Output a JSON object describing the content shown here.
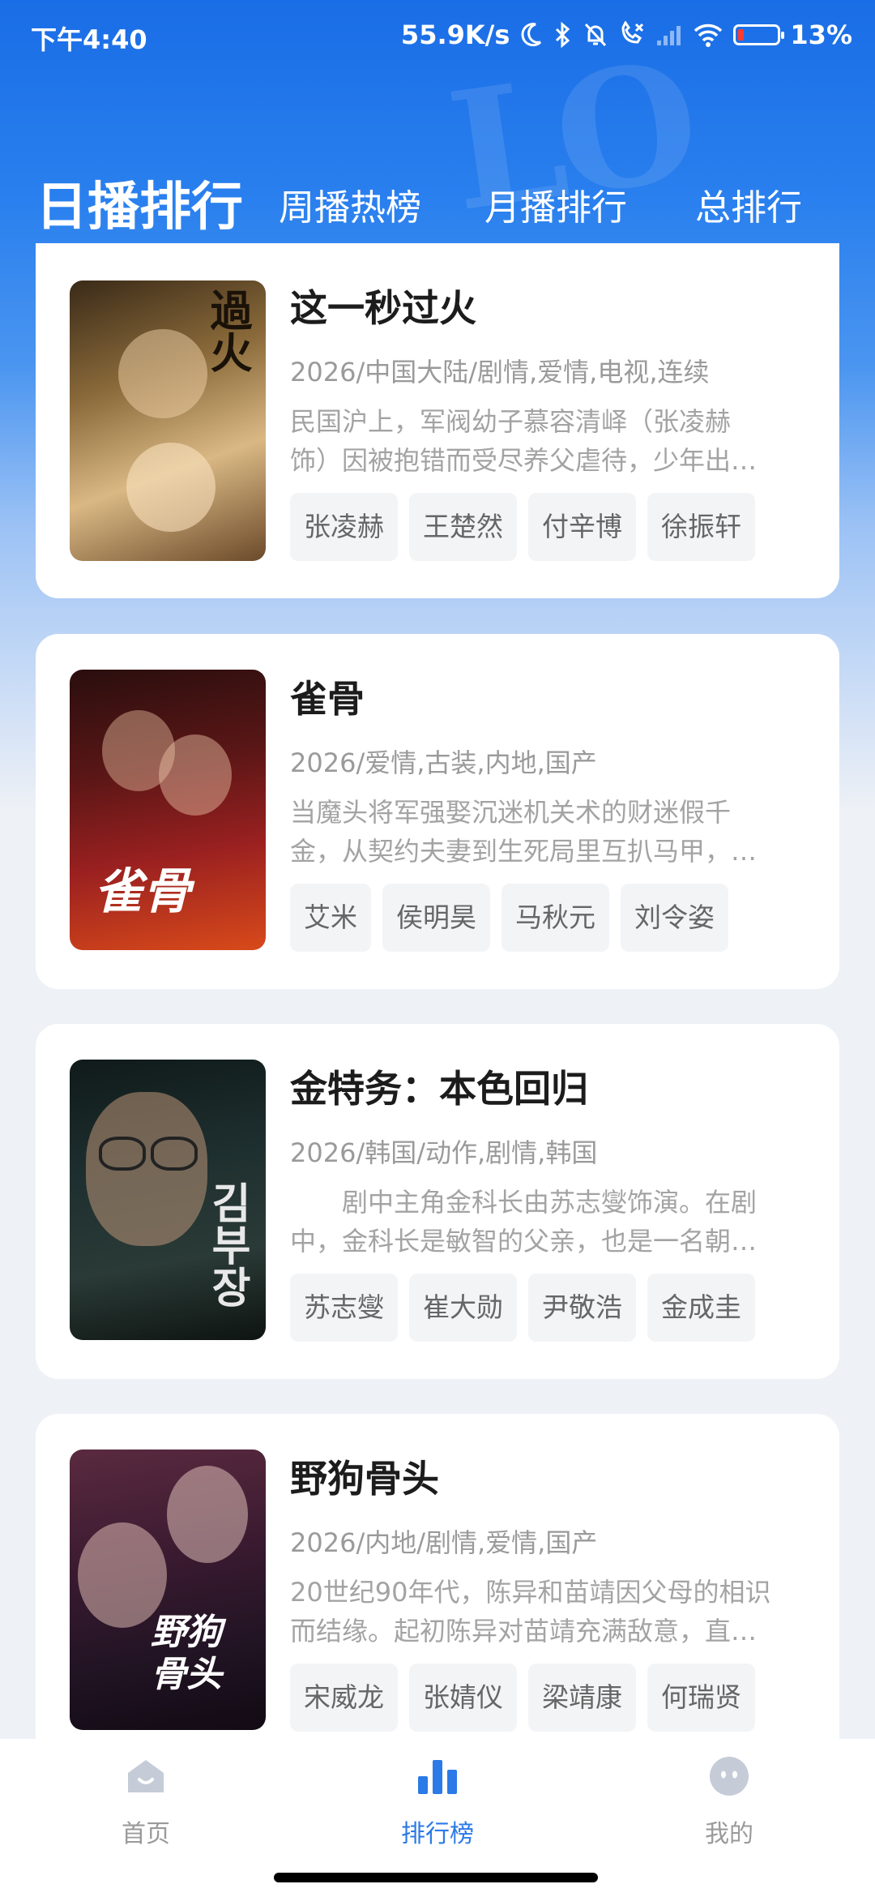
{
  "status_bar": {
    "time": "下午4:40",
    "speed": "55.9K/s",
    "battery": "13%",
    "icons": [
      "moon-icon",
      "bluetooth-icon",
      "bell-off-icon",
      "call-off-icon",
      "signal-icon",
      "wifi-icon",
      "battery-icon"
    ]
  },
  "tabs": [
    {
      "label": "日播排行",
      "active": true
    },
    {
      "label": "周播热榜",
      "active": false
    },
    {
      "label": "月播排行",
      "active": false
    },
    {
      "label": "总排行",
      "active": false
    }
  ],
  "items": [
    {
      "title": "这一秒过火",
      "meta": "2026/中国大陆/剧情,爱情,电视,连续",
      "desc_line1": "民国沪上，军阀幼子慕容清峄（张凌赫",
      "desc_line2": "饰）因被抱错而受尽养父虐待，少年出…",
      "tags": [
        "张凌赫",
        "王楚然",
        "付辛博",
        "徐振轩"
      ],
      "poster_text": "過火"
    },
    {
      "title": "雀骨",
      "meta": "2026/爱情,古装,内地,国产",
      "desc_line1": "当魔头将军强娶沉迷机关术的财迷假千",
      "desc_line2": "金，从契约夫妻到生死局里互扒马甲，…",
      "tags": [
        "艾米",
        "侯明昊",
        "马秋元",
        "刘令姿"
      ],
      "poster_text": "雀骨"
    },
    {
      "title": "金特务：本色回归",
      "meta": "2026/韩国/动作,剧情,韩国",
      "desc_line1": "　　剧中主角金科长由苏志燮饰演。在剧",
      "desc_line2": "中，金科长是敏智的父亲，也是一名朝…",
      "tags": [
        "苏志燮",
        "崔大勋",
        "尹敬浩",
        "金成圭"
      ],
      "poster_text": "김부장"
    },
    {
      "title": "野狗骨头",
      "meta": "2026/内地/剧情,爱情,国产",
      "desc_line1": "20世纪90年代，陈异和苗靖因父母的相识",
      "desc_line2": "而结缘。起初陈异对苗靖充满敌意，直…",
      "tags": [
        "宋威龙",
        "张婧仪",
        "梁靖康",
        "何瑞贤"
      ],
      "poster_text": "野狗骨头"
    }
  ],
  "nav": [
    {
      "label": "首页",
      "icon": "home-icon",
      "active": false
    },
    {
      "label": "排行榜",
      "icon": "ranking-icon",
      "active": true
    },
    {
      "label": "我的",
      "icon": "profile-icon",
      "active": false
    }
  ],
  "colors": {
    "accent": "#2b7ae8",
    "header_blue": "#1a6de6"
  }
}
